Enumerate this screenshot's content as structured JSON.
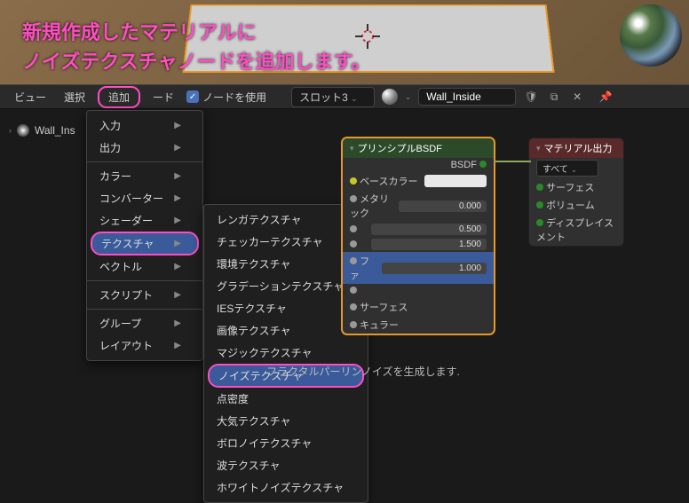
{
  "annotation": {
    "line1": "新規作成したマテリアルに",
    "line2": "ノイズテクスチャノードを追加します。"
  },
  "toolbar": {
    "view": "ビュー",
    "select": "選択",
    "add": "追加",
    "node": "ード",
    "use_nodes": "ノードを使用",
    "slot": "スロット3",
    "material_name": "Wall_Inside"
  },
  "breadcrumb": {
    "item": "Wall_Ins"
  },
  "add_menu": {
    "items": [
      {
        "label": "入力",
        "arrow": true
      },
      {
        "label": "出力",
        "arrow": true
      },
      {
        "sep": true
      },
      {
        "label": "カラー",
        "arrow": true
      },
      {
        "label": "コンバーター",
        "arrow": true
      },
      {
        "label": "シェーダー",
        "arrow": true
      },
      {
        "label": "テクスチャ",
        "arrow": true,
        "highlight": true
      },
      {
        "label": "ベクトル",
        "arrow": true
      },
      {
        "sep": true
      },
      {
        "label": "スクリプト",
        "arrow": true
      },
      {
        "sep": true
      },
      {
        "label": "グループ",
        "arrow": true
      },
      {
        "label": "レイアウト",
        "arrow": true
      }
    ]
  },
  "tex_menu": {
    "items": [
      "レンガテクスチャ",
      "チェッカーテクスチャ",
      "環境テクスチャ",
      "グラデーションテクスチャ",
      "IESテクスチャ",
      "画像テクスチャ",
      "マジックテクスチャ",
      "ノイズテクスチャ",
      "点密度",
      "大気テクスチャ",
      "ボロノイテクスチャ",
      "波テクスチャ",
      "ホワイトノイズテクスチャ"
    ],
    "highlight_index": 7,
    "tooltip": "フラクタルパーリンノイズを生成します."
  },
  "bsdf_node": {
    "title": "プリンシプルBSDF",
    "out": "BSDF",
    "rows": [
      {
        "label": "ベースカラー",
        "swatch": true
      },
      {
        "label": "メタリック",
        "value": "0.000"
      },
      {
        "label": "",
        "value": "0.500"
      },
      {
        "label": "",
        "value": "1.500"
      },
      {
        "label": "ファ",
        "value": "1.000",
        "blue": true
      },
      {
        "label": ""
      },
      {
        "label": "サーフェス"
      },
      {
        "label": "キュラー"
      }
    ]
  },
  "out_node": {
    "title": "マテリアル出力",
    "target": "すべて",
    "inputs": [
      "サーフェス",
      "ボリューム",
      "ディスプレイスメント"
    ]
  }
}
